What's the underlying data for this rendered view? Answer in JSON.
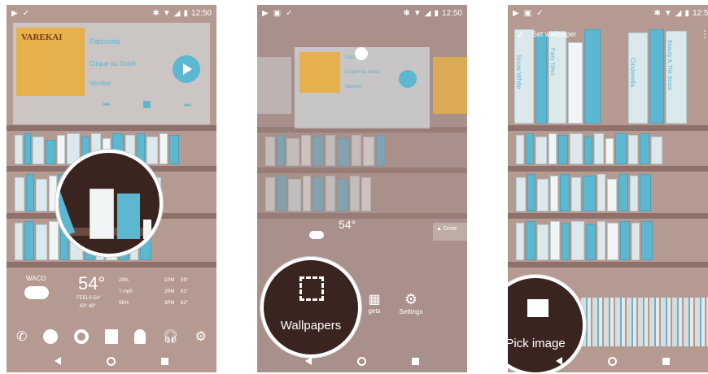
{
  "status_bar": {
    "time": "12:50"
  },
  "panel1": {
    "music": {
      "album_art_text": "VAREKAI",
      "title": "Patzivota",
      "artist": "Cirque du Soleil",
      "album": "Varekai"
    },
    "weather": {
      "location": "WACO",
      "temp": "54°",
      "feels_like": "FEELS 54°",
      "range": "63° 48°",
      "details": [
        "28%",
        "7 mph",
        "56%"
      ],
      "hourly": [
        {
          "time": "1PM",
          "temp": "59°"
        },
        {
          "time": "2PM",
          "temp": "61°"
        },
        {
          "time": "3PM",
          "temp": "62°"
        }
      ]
    },
    "dock_icons": [
      "phone-icon",
      "hangouts-icon",
      "chrome-icon",
      "maps-icon",
      "android-icon",
      "headphones-icon",
      "settings-icon"
    ]
  },
  "panel2": {
    "music": {
      "title": "Patzivota",
      "artist": "Cirque du Soleil",
      "album": "Varekai"
    },
    "weather": {
      "temp": "54°"
    },
    "drive_label": "Drive",
    "menu": {
      "wallpapers_label": "Wallpapers",
      "widgets_label": "gets",
      "settings_label": "Settings"
    }
  },
  "panel3": {
    "set_wallpaper_label": "Set wallpaper",
    "pick_image_label": "Pick image",
    "book_titles": [
      "Snow White",
      "Fairy Tales",
      "Cinderella",
      "Beauty & The Beast"
    ]
  },
  "colors": {
    "accent": "#5cb7d1",
    "plank": "#8d716a",
    "wall": "#b59a92"
  }
}
